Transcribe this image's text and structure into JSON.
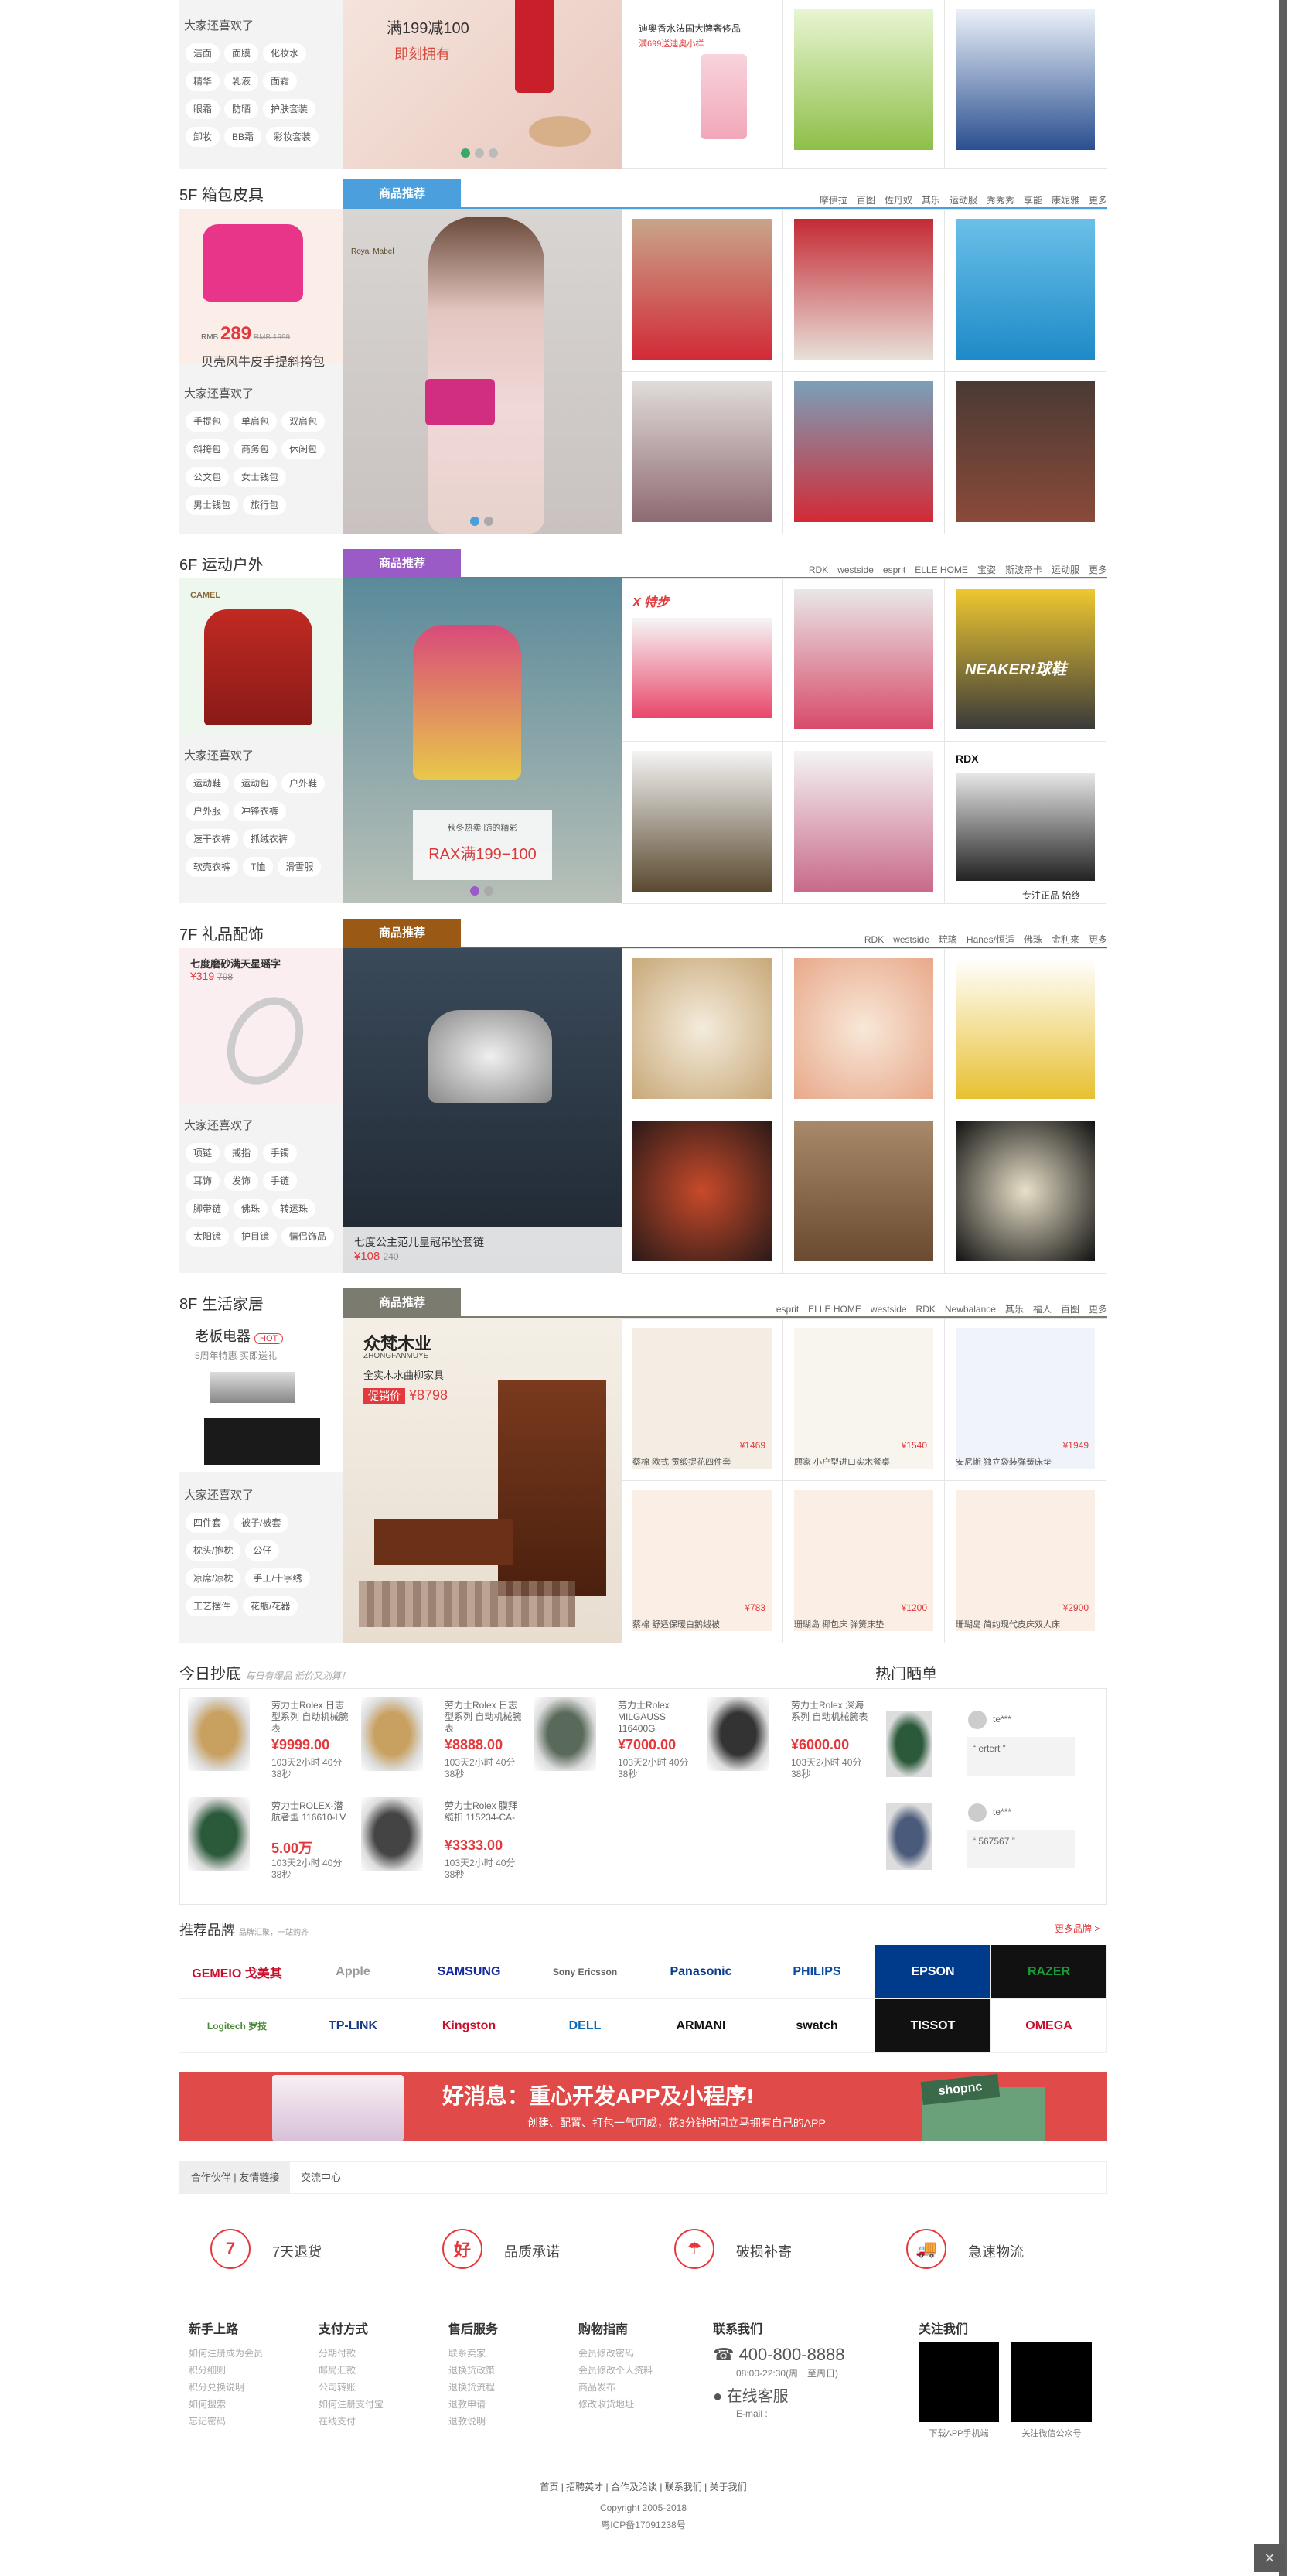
{
  "top": {
    "guess": "大家还喜欢了",
    "tags": [
      "洁面",
      "面膜",
      "化妆水",
      "精华",
      "乳液",
      "面霜",
      "眼霜",
      "防晒",
      "护肤套装",
      "卸妆",
      "BB霜",
      "彩妆套装"
    ],
    "banner_text1": "满199减100",
    "banner_text2": "即刻拥有",
    "cell_title": "迪奥香水法国大牌奢侈品",
    "cell_sub": "满699送迪奥小样"
  },
  "floors": [
    {
      "id": "5f",
      "title": "5F  箱包皮具",
      "tab": "商品推荐",
      "color": "#4a9fdc",
      "brands": [
        "摩伊拉",
        "百图",
        "佐丹奴",
        "其乐",
        "运动服",
        "秀秀秀",
        "享能",
        "康妮雅",
        "更多"
      ],
      "promo_price_prefix": "RMB",
      "promo_price": "289",
      "promo_old": "RMB 1699",
      "promo_name": "贝壳风牛皮手提斜挎包",
      "guess": "大家还喜欢了",
      "tags": [
        "手提包",
        "单肩包",
        "双肩包",
        "斜挎包",
        "商务包",
        "休闲包",
        "公文包",
        "女士钱包",
        "男士钱包",
        "旅行包"
      ],
      "banner_logo": "Royal Mabel"
    },
    {
      "id": "6f",
      "title": "6F  运动户外",
      "tab": "商品推荐",
      "color": "#9a5bc6",
      "brands": [
        "RDK",
        "westside",
        "esprit",
        "ELLE HOME",
        "宝姿",
        "斯波帝卡",
        "运动服",
        "更多"
      ],
      "guess": "大家还喜欢了",
      "tags": [
        "运动鞋",
        "运动包",
        "户外鞋",
        "户外服",
        "冲锋衣裤",
        "速干衣裤",
        "抓绒衣裤",
        "软壳衣裤",
        "T恤",
        "滑雪服"
      ],
      "banner_text1": "秋冬热卖 随的精彩",
      "banner_text2": "RAX满199−100",
      "left_logo": "CAMEL",
      "cell_text1": "X 特步",
      "cell_text2": "NEAKER!球鞋",
      "cell_text3": "RDX",
      "cell_caption": "专注正品 始终"
    },
    {
      "id": "7f",
      "title": "7F  礼品配饰",
      "tab": "商品推荐",
      "color": "#9a5a16",
      "brands": [
        "RDK",
        "westside",
        "琉璃",
        "Hanes/恒适",
        "佛珠",
        "金利来",
        "更多"
      ],
      "promo_name": "七度磨砂满天星瑶字",
      "promo_price": "¥319",
      "promo_old": "798",
      "guess": "大家还喜欢了",
      "tags": [
        "项链",
        "戒指",
        "手镯",
        "耳饰",
        "发饰",
        "手链",
        "脚带链",
        "佛珠",
        "转运珠",
        "太阳镜",
        "护目镜",
        "情侣饰品"
      ],
      "banner_name": "七度公主范儿皇冠吊坠套链",
      "banner_price": "¥108",
      "banner_old": "240"
    },
    {
      "id": "8f",
      "title": "8F  生活家居",
      "tab": "商品推荐",
      "color": "#7b7b70",
      "brands": [
        "esprit",
        "ELLE HOME",
        "westside",
        "RDK",
        "Newbalance",
        "其乐",
        "福人",
        "百图",
        "更多"
      ],
      "promo_name": "老板电器",
      "promo_hot": "HOT",
      "promo_sub": "5周年特惠 买即送礼",
      "guess": "大家还喜欢了",
      "tags": [
        "四件套",
        "被子/被套",
        "枕头/抱枕",
        "公仔",
        "凉席/凉枕",
        "手工/十字绣",
        "工艺摆件",
        "花瓶/花器"
      ],
      "banner_brand": "众梵木业",
      "banner_en": "ZHONGFANMUYE",
      "banner_sub": "全实木水曲柳家具",
      "banner_tag": "促销价",
      "banner_price": "¥8798",
      "items": [
        {
          "price": "¥1469",
          "name": "蔡棉 欧式 贡缎提花四件套"
        },
        {
          "price": "¥1540",
          "name": "顾家 小户型进口实木餐桌"
        },
        {
          "price": "¥1949",
          "name": "安尼斯 独立袋装弹簧床垫"
        },
        {
          "price": "¥783",
          "name": "蔡棉 舒适保暖白鹅绒被"
        },
        {
          "price": "¥1200",
          "name": "珊瑚岛 椰包床 弹簧床垫"
        },
        {
          "price": "¥2900",
          "name": "珊瑚岛 简约现代皮床双人床"
        }
      ]
    }
  ],
  "today": {
    "title": "今日抄底",
    "subtitle": "每日有爆品 低价又划算！",
    "items": [
      {
        "name": "劳力士Rolex 日志型系列 自动机械腕表",
        "price": "¥9999.00",
        "count": "103天2小时 40分38秒"
      },
      {
        "name": "劳力士Rolex 日志型系列 自动机械腕表",
        "price": "¥8888.00",
        "count": "103天2小时 40分38秒"
      },
      {
        "name": "劳力士Rolex MILGAUSS 116400G",
        "price": "¥7000.00",
        "count": "103天2小时 40分38秒"
      },
      {
        "name": "劳力士Rolex 深海系列 自动机械腕表",
        "price": "¥6000.00",
        "count": "103天2小时 40分38秒"
      },
      {
        "name": "劳力士ROLEX-潜航者型 116610-LV",
        "price": "5.00万",
        "count": "103天2小时 40分38秒"
      },
      {
        "name": "劳力士Rolex 膜拜 缆扣 115234-CA-",
        "price": "¥3333.00",
        "count": "103天2小时 40分38秒"
      }
    ]
  },
  "hot": {
    "title": "热门晒单",
    "items": [
      {
        "user": "te***",
        "comment": "ertert"
      },
      {
        "user": "te***",
        "comment": "567567"
      }
    ]
  },
  "brands": {
    "title": "推荐品牌",
    "subtitle": "品牌汇聚，一站购齐",
    "more": "更多品牌 >",
    "list": [
      "GEMEIO 戈美其",
      "Apple",
      "SAMSUNG",
      "Sony Ericsson",
      "Panasonic",
      "PHILIPS",
      "EPSON",
      "RAZER",
      "Logitech 罗技",
      "TP-LINK",
      "Kingston",
      "DELL",
      "ARMANI",
      "swatch",
      "TISSOT",
      "OMEGA"
    ]
  },
  "promo": {
    "title": "好消息：重心开发APP及小程序!",
    "sub": "创建、配置、打包一气呵成，花3分钟时间立马拥有自己的APP",
    "shop": "shopnc"
  },
  "partners": {
    "tab1": "合作伙伴 | 友情链接",
    "tab2": "交流中心"
  },
  "service": [
    {
      "icon": "7",
      "label": "7天退货"
    },
    {
      "icon": "好",
      "label": "品质承诺"
    },
    {
      "icon": "☂",
      "label": "破损补寄"
    },
    {
      "icon": "🚚",
      "label": "急速物流"
    }
  ],
  "footer": {
    "cols": [
      {
        "title": "新手上路",
        "items": [
          "如何注册成为会员",
          "积分细则",
          "积分兑换说明",
          "如何搜索",
          "忘记密码"
        ]
      },
      {
        "title": "支付方式",
        "items": [
          "分期付款",
          "邮局汇款",
          "公司转账",
          "如何注册支付宝",
          "在线支付"
        ]
      },
      {
        "title": "售后服务",
        "items": [
          "联系卖家",
          "退换货政策",
          "退换货流程",
          "退款申请",
          "退款说明"
        ]
      },
      {
        "title": "购物指南",
        "items": [
          "会员修改密码",
          "会员修改个人资料",
          "商品发布",
          "修改收货地址"
        ]
      }
    ],
    "contact_title": "联系我们",
    "phone": "400-800-8888",
    "hours": "08:00-22:30(周一至周日)",
    "online": "在线客服",
    "email": "E-mail :",
    "follow_title": "关注我们",
    "qr1": "下载APP手机端",
    "qr2": "关注微信公众号",
    "links": [
      "首页",
      "招聘英才",
      "合作及洽谈",
      "联系我们",
      "关于我们"
    ],
    "copyright": "Copyright 2005-2018",
    "icp": "粤ICP备17091238号"
  }
}
